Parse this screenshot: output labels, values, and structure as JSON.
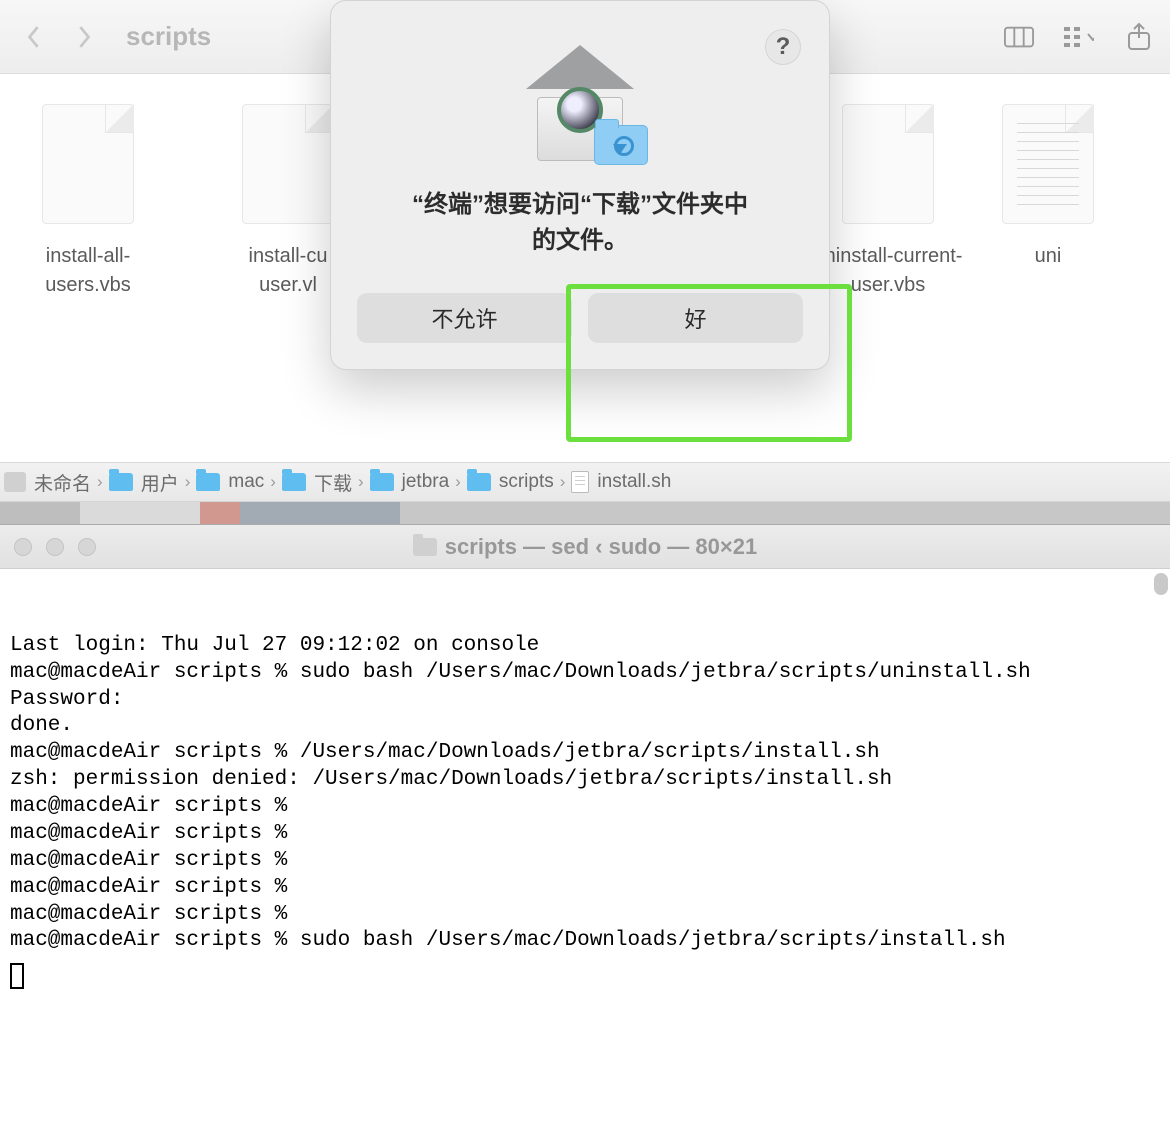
{
  "finder": {
    "location_title": "scripts",
    "files": [
      {
        "name": "install-all-users.vbs"
      },
      {
        "name": "install-current-user.vbs",
        "truncated_label": "install-cur\nuser.vl"
      },
      {
        "name": "",
        "hidden_behind_modal": true
      },
      {
        "name": "",
        "hidden_behind_modal": true
      },
      {
        "name": "uninstall-current-user.vbs"
      },
      {
        "name": "uninstall.sh",
        "truncated_label": "uni"
      }
    ],
    "pathbar": [
      {
        "label": "未命名",
        "icon": "disk"
      },
      {
        "label": "用户",
        "icon": "folder"
      },
      {
        "label": "mac",
        "icon": "folder"
      },
      {
        "label": "下载",
        "icon": "folder"
      },
      {
        "label": "jetbra",
        "icon": "folder"
      },
      {
        "label": "scripts",
        "icon": "folder"
      },
      {
        "label": "install.sh",
        "icon": "doc"
      }
    ]
  },
  "dialog": {
    "message_line1": "“终端”想要访问“下载”文件夹中",
    "message_line2": "的文件。",
    "deny_label": "不允许",
    "allow_label": "好",
    "help_tooltip": "?"
  },
  "terminal": {
    "title": "scripts — sed ‹ sudo — 80×21",
    "lines": [
      "Last login: Thu Jul 27 09:12:02 on console",
      "mac@macdeAir scripts % sudo bash /Users/mac/Downloads/jetbra/scripts/uninstall.sh",
      "Password:",
      "done.",
      "mac@macdeAir scripts % /Users/mac/Downloads/jetbra/scripts/install.sh",
      "zsh: permission denied: /Users/mac/Downloads/jetbra/scripts/install.sh",
      "mac@macdeAir scripts % ",
      "mac@macdeAir scripts % ",
      "mac@macdeAir scripts % ",
      "mac@macdeAir scripts % ",
      "mac@macdeAir scripts % ",
      "mac@macdeAir scripts % sudo bash /Users/mac/Downloads/jetbra/scripts/install.sh"
    ]
  }
}
